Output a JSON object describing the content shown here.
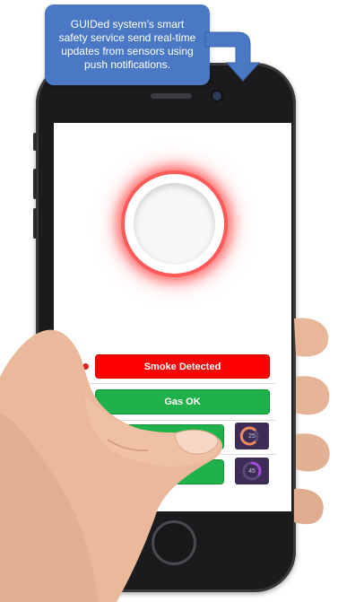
{
  "tooltip": {
    "text": "GUIDed system’s smart safety service send real-time updates from sensors using push notifications."
  },
  "status_rows": [
    {
      "label": "Smoke Detected",
      "color": "#ff0000",
      "dot_color": "#e02020"
    },
    {
      "label": "Gas OK",
      "color": "#1fb14a",
      "dot_color": "#2fb84a"
    },
    {
      "label": "",
      "color": "#1fb14a",
      "dot_color": "#2fb84a"
    },
    {
      "label": "",
      "color": "#1fb14a",
      "dot_color": "#2fb84a"
    }
  ],
  "gauges": [
    {
      "value": "25",
      "accent": "#f08a5d"
    },
    {
      "value": "45",
      "accent": "#a24bd6"
    }
  ],
  "colors": {
    "tooltip_bg": "#4a78c5",
    "alert_red": "#ff0000",
    "ok_green": "#1fb14a",
    "phone_body": "#1b1b1d"
  },
  "icons": {
    "tooltip_pointer": "arrow-down-icon",
    "sensor": "smoke-sensor-icon"
  }
}
